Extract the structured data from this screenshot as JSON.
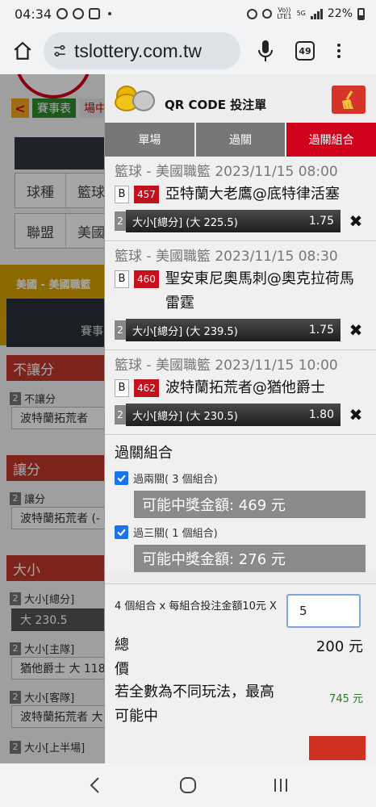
{
  "status": {
    "time": "04:34",
    "battery": "22%",
    "network": "5G",
    "volte": "Vo))",
    "lte": "LTE1"
  },
  "browser": {
    "url": "tslottery.com.tw",
    "tab_count": "49"
  },
  "background": {
    "tabs": [
      "賽事表",
      "場中"
    ],
    "form": [
      {
        "label": "球種",
        "value": "籃球"
      },
      {
        "label": "聯盟",
        "value": "美國"
      }
    ],
    "league_title": "美國 - 美國職籃",
    "league_text": "賽事",
    "sections": [
      {
        "title": "不讓分",
        "item": "不讓分",
        "item_num": "2",
        "box": "波特蘭拓荒者"
      },
      {
        "title": "讓分",
        "item": "讓分",
        "item_num": "2",
        "box": "波特蘭拓荒者 (-"
      },
      {
        "title": "大小",
        "item": "大小[總分]",
        "item_num": "2",
        "box": "大 230.5"
      }
    ],
    "extra_items": [
      {
        "num": "2",
        "label": "大小[主隊]",
        "box": "猶他爵士 大 118"
      },
      {
        "num": "2",
        "label": "大小[客隊]",
        "box": "波特蘭拓荒者 大"
      },
      {
        "num": "2",
        "label": "大小[上半場]"
      }
    ]
  },
  "panel": {
    "title": "QR CODE 投注單",
    "tabs": [
      "單場",
      "過關",
      "過關組合"
    ],
    "active_tab": "過關組合",
    "bets": [
      {
        "meta": "籃球 - 美國職籃 2023/11/15 08:00",
        "type_badge": "B",
        "game_no": "457",
        "match": "亞特蘭大老鷹@底特律活塞",
        "idx": "2",
        "selection": "大小[總分] (大 225.5)",
        "odds": "1.75"
      },
      {
        "meta": "籃球 - 美國職籃 2023/11/15 08:30",
        "type_badge": "B",
        "game_no": "460",
        "match": "聖安東尼奧馬刺@奧克拉荷馬雷霆",
        "idx": "2",
        "selection": "大小[總分] (大 239.5)",
        "odds": "1.75"
      },
      {
        "meta": "籃球 - 美國職籃 2023/11/15 10:00",
        "type_badge": "B",
        "game_no": "462",
        "match": "波特蘭拓荒者@猶他爵士",
        "idx": "2",
        "selection": "大小[總分] (大 230.5)",
        "odds": "1.80"
      }
    ],
    "combo": {
      "title": "過關組合",
      "options": [
        {
          "label": "過兩關( 3 個組合)",
          "checked": true,
          "prize": "可能中獎金額: 469 元"
        },
        {
          "label": "過三關( 1 個組合)",
          "checked": true,
          "prize": "可能中獎金額: 276 元"
        }
      ]
    },
    "amount": {
      "label": "4 個組合 x 每組合投注金額10元 X",
      "value": "5"
    },
    "total": {
      "label": "總價",
      "value": "200 元"
    },
    "max": {
      "label": "若全數為不同玩法，最高可能中",
      "value": "745 元"
    }
  },
  "colors": {
    "brand_red": "#d0021b",
    "bet_bar": "#2b2b2b",
    "prize_box": "#8a8a8a",
    "checkbox": "#1a73e8",
    "max_value": "#2b7a2b"
  }
}
